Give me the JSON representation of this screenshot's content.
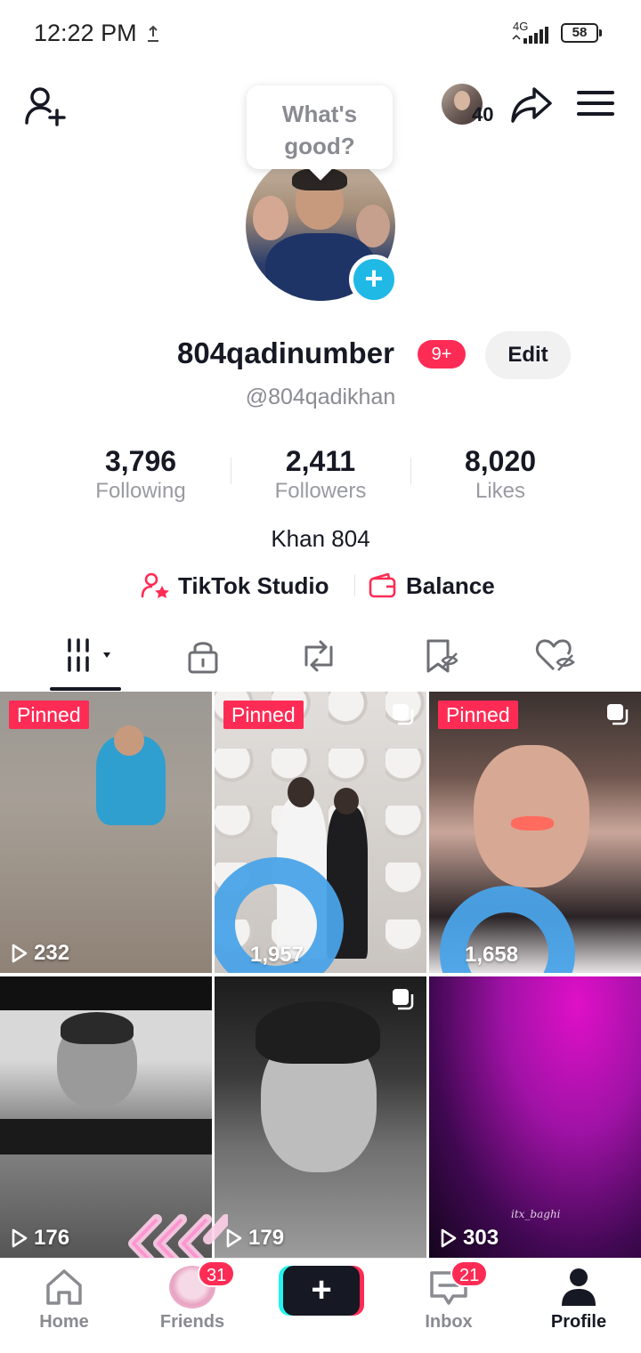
{
  "status_bar": {
    "time": "12:22 PM",
    "network": "4G",
    "battery": "58"
  },
  "header": {
    "visitor_count": "40"
  },
  "bubble": {
    "line1": "What's",
    "line2": "good?"
  },
  "profile": {
    "display_name": "804qadinumber",
    "badge": "9+",
    "edit_label": "Edit",
    "username": "@804qadikhan",
    "bio": "Khan 804"
  },
  "stats": [
    {
      "value": "3,796",
      "label": "Following"
    },
    {
      "value": "2,411",
      "label": "Followers"
    },
    {
      "value": "8,020",
      "label": "Likes"
    }
  ],
  "links": {
    "studio": "TikTok Studio",
    "balance": "Balance"
  },
  "tabs": [
    "videos-grid-icon",
    "lock-icon",
    "repost-icon",
    "favorites-icon",
    "liked-icon"
  ],
  "videos": [
    {
      "pinned": "Pinned",
      "views": "232"
    },
    {
      "pinned": "Pinned",
      "views": "1,957"
    },
    {
      "pinned": "Pinned",
      "views": "1,658"
    },
    {
      "views": "176"
    },
    {
      "views": "179"
    },
    {
      "views": "303",
      "watermark": "itx_baghi"
    }
  ],
  "bottom_nav": {
    "home": "Home",
    "friends": "Friends",
    "friends_badge": "31",
    "create": "+",
    "inbox": "Inbox",
    "inbox_badge": "21",
    "profile": "Profile"
  },
  "colors": {
    "accent": "#fe2c55",
    "cyan": "#25f4ee",
    "add_blue": "#20b9e6",
    "loader_blue": "#4aa3e8"
  }
}
